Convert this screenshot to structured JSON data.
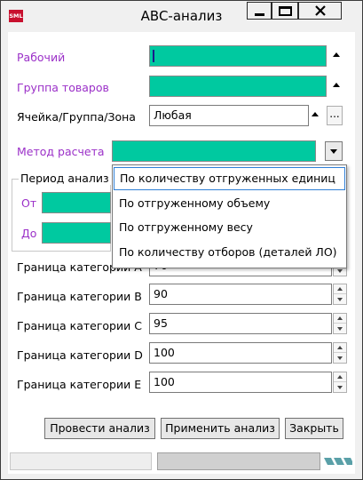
{
  "window": {
    "title": "ABC-анализ",
    "icon_text": "SML",
    "icon_color": "#c8102e"
  },
  "accent_colors": {
    "field_fill": "#00c9a0",
    "label_purple": "#9b30c8",
    "selection_border": "#2f7fd6"
  },
  "form": {
    "worker_label": "Рабочий",
    "worker_value": "",
    "product_group_label": "Группа товаров",
    "product_group_value": "",
    "location_label": "Ячейка/Группа/Зона",
    "location_value": "Любая",
    "location_browse": "...",
    "method_label": "Метод расчета",
    "method_value": "",
    "period_label": "Период анализ",
    "from_label": "От",
    "to_label": "До"
  },
  "categories": [
    {
      "label": "Граница категории А",
      "value": "70"
    },
    {
      "label": "Граница категории В",
      "value": "90"
    },
    {
      "label": "Граница категории С",
      "value": "95"
    },
    {
      "label": "Граница категории D",
      "value": "100"
    },
    {
      "label": "Граница категории Е",
      "value": "100"
    }
  ],
  "method_options": [
    {
      "label": "По количеству отгруженных единиц",
      "selected": true
    },
    {
      "label": "По отгруженному объему",
      "selected": false
    },
    {
      "label": "По отгруженному весу",
      "selected": false
    },
    {
      "label": "По количеству отборов (деталей ЛО)",
      "selected": false
    }
  ],
  "buttons": {
    "run": "Провести анализ",
    "apply": "Применить анализ",
    "close": "Закрыть"
  }
}
